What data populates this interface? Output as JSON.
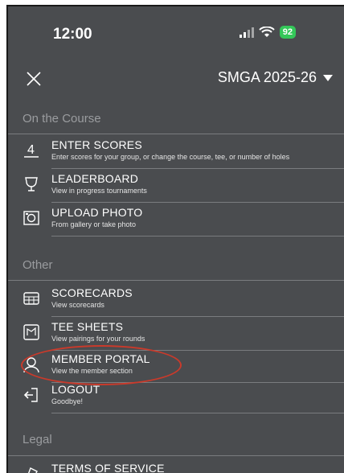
{
  "status_bar": {
    "time": "12:00",
    "battery": "92"
  },
  "header": {
    "season": "SMGA 2025-26"
  },
  "sections": {
    "course": {
      "title": "On the Course",
      "items": [
        {
          "icon": "enter-scores-icon",
          "label": "ENTER SCORES",
          "sub": "Enter scores for your group, or change the course, tee, or number of holes"
        },
        {
          "icon": "trophy-icon",
          "label": "LEADERBOARD",
          "sub": "View in progress tournaments"
        },
        {
          "icon": "camera-icon",
          "label": "UPLOAD PHOTO",
          "sub": "From gallery or take photo"
        }
      ]
    },
    "other": {
      "title": "Other",
      "items": [
        {
          "icon": "scorecard-icon",
          "label": "SCORECARDS",
          "sub": "View scorecards"
        },
        {
          "icon": "tee-sheet-icon",
          "label": "TEE SHEETS",
          "sub": "View pairings for your rounds"
        },
        {
          "icon": "member-icon",
          "label": "MEMBER PORTAL",
          "sub": "View the member section"
        },
        {
          "icon": "logout-icon",
          "label": "LOGOUT",
          "sub": "Goodbye!"
        }
      ]
    },
    "legal": {
      "title": "Legal",
      "items": [
        {
          "icon": "document-icon",
          "label": "TERMS OF SERVICE",
          "sub": ""
        }
      ]
    }
  },
  "colors": {
    "background": "#4a4c4f",
    "annotation": "#c93a2b",
    "battery": "#34c759"
  }
}
